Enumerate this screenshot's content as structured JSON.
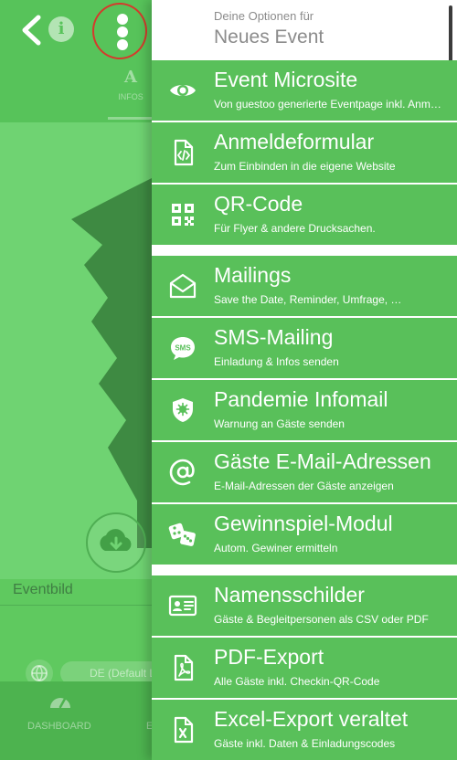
{
  "background": {
    "tab": {
      "icon": "A",
      "label": "INFOS"
    },
    "eventbild_label": "Eventbild",
    "language_value": "DE (Default L",
    "bottom_nav": {
      "dashboard_label": "DASHBOARD",
      "second_label": "E"
    }
  },
  "icons": {
    "back": "chevron-left-icon",
    "info": "info-icon",
    "menu": "more-vertical-icon"
  },
  "options": {
    "subtitle": "Deine Optionen für",
    "title": "Neues Event",
    "items": [
      {
        "title": "Event Microsite",
        "subtitle": "Von guestoo generierte Eventpage inkl. Anm…",
        "icon": "eye-icon"
      },
      {
        "title": "Anmeldeformular",
        "subtitle": "Zum Einbinden in die eigene Website",
        "icon": "code-file-icon"
      },
      {
        "title": "QR-Code",
        "subtitle": "Für Flyer & andere Drucksachen.",
        "icon": "qr-code-icon"
      },
      {
        "title": "Mailings",
        "subtitle": "Save the Date, Reminder, Umfrage, …",
        "icon": "envelope-open-icon"
      },
      {
        "title": "SMS-Mailing",
        "subtitle": "Einladung & Infos senden",
        "icon": "sms-icon"
      },
      {
        "title": "Pandemie Infomail",
        "subtitle": "Warnung an Gäste senden",
        "icon": "shield-virus-icon"
      },
      {
        "title": "Gäste E-Mail-Adressen",
        "subtitle": "E-Mail-Adressen der Gäste anzeigen",
        "icon": "at-sign-icon"
      },
      {
        "title": "Gewinnspiel-Modul",
        "subtitle": "Autom. Gewiner ermitteln",
        "icon": "dice-icon"
      },
      {
        "title": "Namensschilder",
        "subtitle": "Gäste & Begleitpersonen als CSV oder PDF",
        "icon": "id-card-icon"
      },
      {
        "title": "PDF-Export",
        "subtitle": "Alle Gäste inkl. Checkin-QR-Code",
        "icon": "pdf-file-icon"
      },
      {
        "title": "Excel-Export veraltet",
        "subtitle": "Gäste inkl. Daten & Einladungscodes",
        "icon": "excel-file-icon"
      }
    ]
  },
  "colors": {
    "menu_item_bg": "#59c05a",
    "app_green": "#57c35a",
    "highlight_ring": "#d53a2c",
    "panel_text_gray": "#8b8b8b"
  }
}
